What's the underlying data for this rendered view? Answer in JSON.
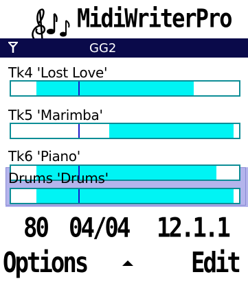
{
  "app": {
    "title": "MidiWriterPro"
  },
  "status": {
    "song": "GG2"
  },
  "tracks": [
    {
      "label": "Tk4 'Lost Love'",
      "fill_start_pct": 0.11,
      "fill_end_pct": 0.8,
      "cursor_pct": 0.295
    },
    {
      "label": "Tk5 'Marimba'",
      "fill_start_pct": 0.43,
      "fill_end_pct": 0.975,
      "cursor_pct": 0.295
    },
    {
      "label": "Tk6 'Piano'",
      "fill_start_pct": 0.11,
      "fill_end_pct": 0.9,
      "cursor_pct": 0.295
    },
    {
      "label": "Drums 'Drums'",
      "fill_start_pct": 0.11,
      "fill_end_pct": 0.975,
      "cursor_pct": 0.295,
      "selected": true
    }
  ],
  "info": {
    "tempo": "80",
    "time_signature": "04/04",
    "position": "12.1.1"
  },
  "softkeys": {
    "left": "Options",
    "right": "Edit"
  },
  "colors": {
    "status_bar": "#0a0a4a",
    "track_fill": "#00f4f4",
    "bar_border": "#0c8d96",
    "selection": "#b4b4ec",
    "cursor": "#1a1ac8"
  }
}
